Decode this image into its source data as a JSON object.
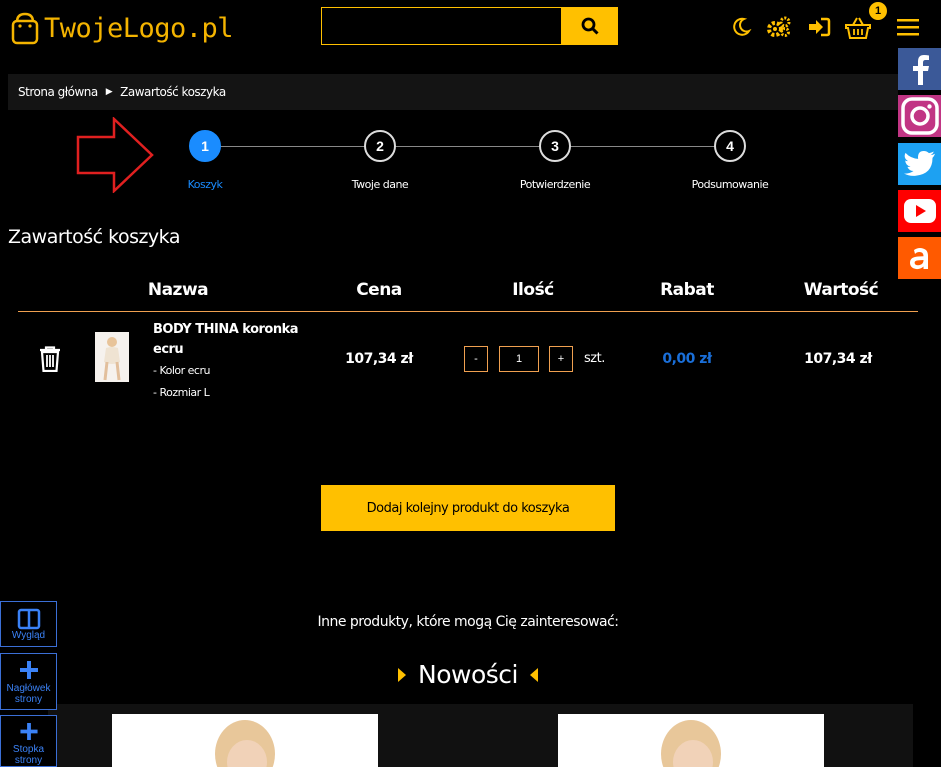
{
  "header": {
    "logo_text": "TwojeLogo.pl",
    "search_placeholder": "",
    "cart_count": "1",
    "icons": [
      "moon-icon",
      "gears-icon",
      "login-icon",
      "basket-icon",
      "menu-icon"
    ]
  },
  "social": [
    "facebook",
    "instagram",
    "twitter",
    "youtube",
    "allegro"
  ],
  "breadcrumb": {
    "home": "Strona główna",
    "current": "Zawartość koszyka"
  },
  "steps": [
    {
      "number": "1",
      "label": "Koszyk",
      "active": true
    },
    {
      "number": "2",
      "label": "Twoje dane",
      "active": false
    },
    {
      "number": "3",
      "label": "Potwierdzenie",
      "active": false
    },
    {
      "number": "4",
      "label": "Podsumowanie",
      "active": false
    }
  ],
  "section_title": "Zawartość koszyka",
  "table": {
    "headers": [
      "Nazwa",
      "Cena",
      "Ilość",
      "Rabat",
      "Wartość"
    ],
    "row": {
      "name": "BODY THINA koronka ecru",
      "options": [
        "- Kolor ecru",
        "- Rozmiar L"
      ],
      "price": "107,34 zł",
      "qty_minus": "-",
      "quantity": "1",
      "qty_plus": "+",
      "unit": "szt.",
      "discount": "0,00 zł",
      "value": "107,34 zł"
    }
  },
  "add_button": "Dodaj kolejny produkt do koszyka",
  "other_products": "Inne produkty, które mogą Cię zainteresować:",
  "new_section": "Nowości",
  "panel": [
    {
      "label": "Wygląd"
    },
    {
      "label": "Nagłówek strony"
    },
    {
      "label": "Stopka strony"
    }
  ],
  "colors": {
    "accent": "#ffc000",
    "active_step": "#1a8cff",
    "discount": "#1a6fd9"
  }
}
